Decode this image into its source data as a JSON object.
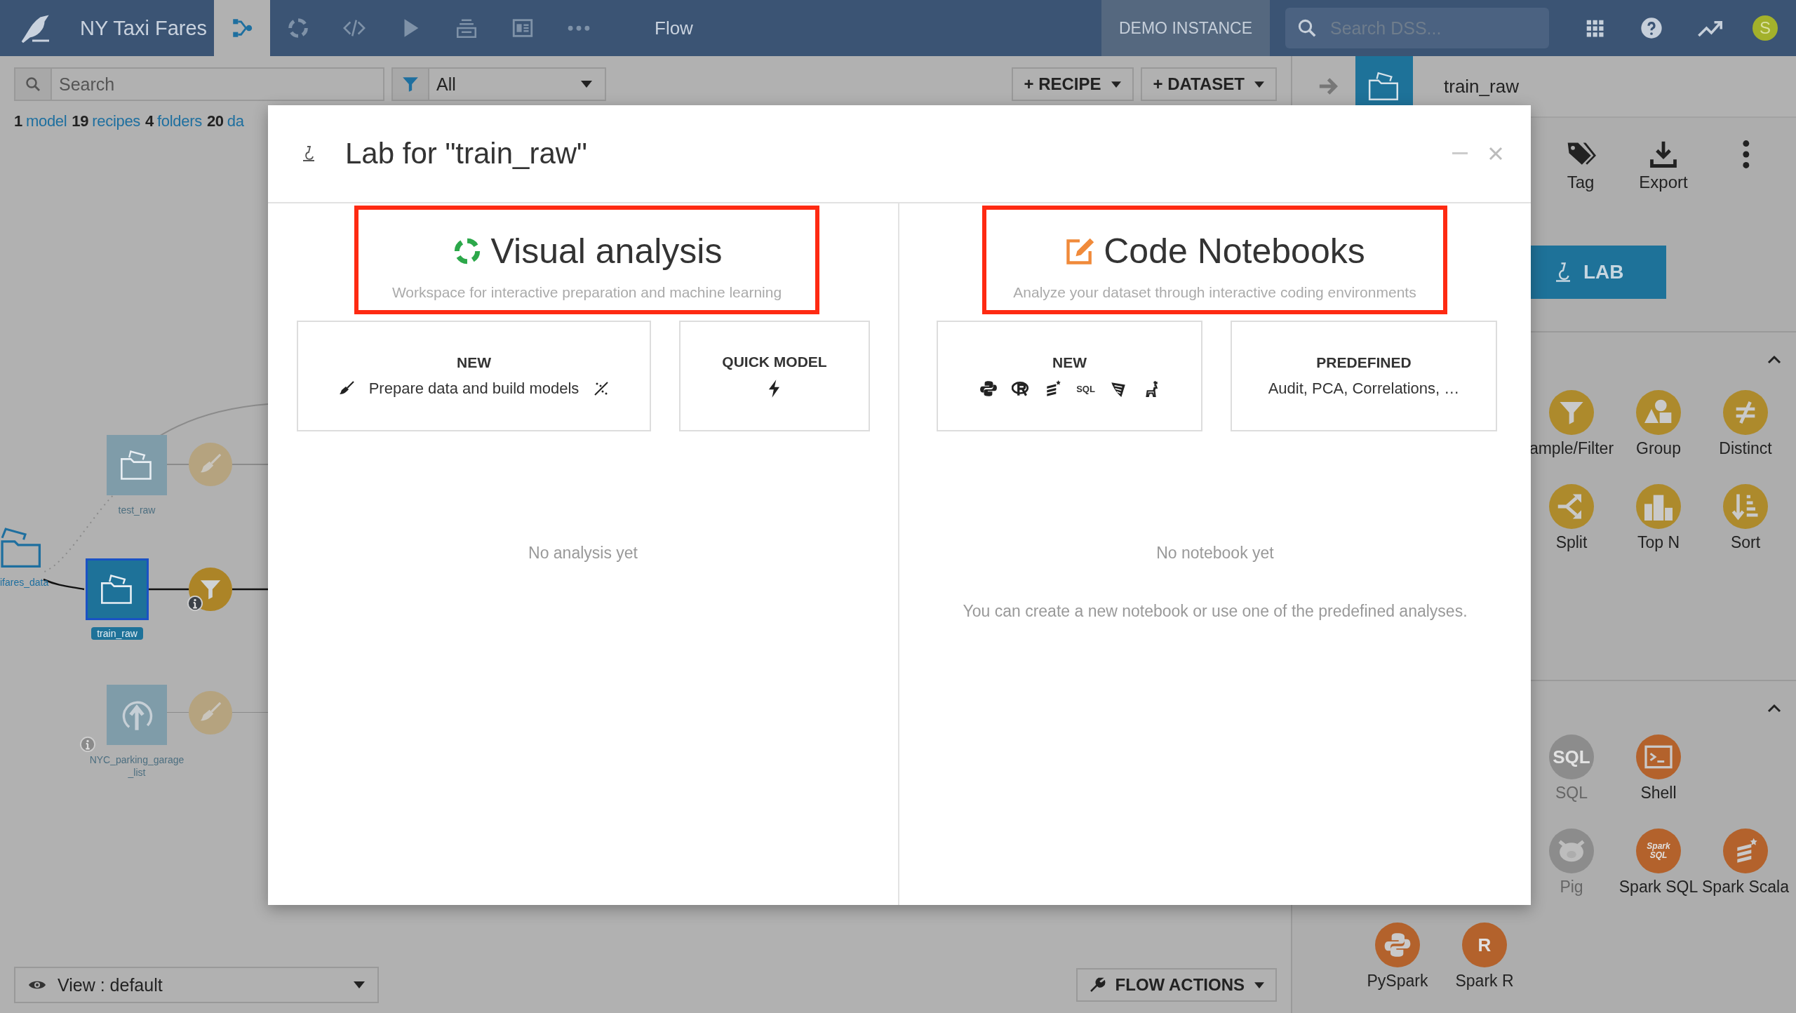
{
  "topbar": {
    "project": "NY Taxi Fares",
    "nav": [
      {
        "kind": "flow",
        "selected": true
      },
      {
        "kind": "analysis",
        "selected": false
      },
      {
        "kind": "code",
        "selected": false
      },
      {
        "kind": "run",
        "selected": false
      },
      {
        "kind": "stack",
        "selected": false
      },
      {
        "kind": "dashboard",
        "selected": false
      },
      {
        "kind": "more",
        "selected": false
      }
    ],
    "section": "Flow",
    "instance": "DEMO INSTANCE",
    "search": {
      "placeholder": "Search DSS..."
    },
    "avatar": "S"
  },
  "toolbar": {
    "search": {
      "placeholder": "Search"
    },
    "filter": "All",
    "buttons": [
      "+ RECIPE",
      "+ DATASET"
    ]
  },
  "stats": [
    {
      "count": "1",
      "label": "model"
    },
    {
      "count": "19",
      "label": "recipes"
    },
    {
      "count": "4",
      "label": "folders"
    },
    {
      "count": "20",
      "label": "da"
    }
  ],
  "flow": {
    "nodes": [
      {
        "kind": "dataset",
        "label": "test_raw",
        "faded": true,
        "selected": false,
        "info": false
      },
      {
        "kind": "folder",
        "label": "ifares_data",
        "faded": false,
        "selected": false,
        "info": false
      },
      {
        "kind": "dataset",
        "label": "train_raw",
        "faded": false,
        "selected": true,
        "info": false
      },
      {
        "kind": "upload",
        "label": "NYC_parking_garage_list",
        "faded": true,
        "selected": false,
        "info": true
      },
      {
        "kind": "prepare",
        "faded": true,
        "selected": false,
        "info": false
      },
      {
        "kind": "filter",
        "faded": false,
        "selected": false,
        "info": true
      },
      {
        "kind": "prepare",
        "faded": true,
        "selected": false,
        "info": false
      }
    ]
  },
  "view": "View : default",
  "flow_actions": "FLOW ACTIONS",
  "right_panel": {
    "item": "train_raw",
    "actions": [
      {
        "kind": "tag",
        "label": "Tag"
      },
      {
        "kind": "export",
        "label": "Export"
      },
      {
        "kind": "more"
      }
    ],
    "lab": "LAB",
    "sections": [
      {
        "expanded": true,
        "items": [
          {
            "kind": "filter",
            "label": "ample/Filter",
            "disabled": false
          },
          {
            "kind": "group",
            "label": "Group",
            "disabled": false
          },
          {
            "kind": "distinct",
            "label": "Distinct",
            "disabled": false
          },
          {
            "kind": "split",
            "label": "Split",
            "disabled": false
          },
          {
            "kind": "topn",
            "label": "Top N",
            "disabled": false
          },
          {
            "kind": "sort",
            "label": "Sort",
            "disabled": false
          }
        ]
      },
      {
        "expanded": true,
        "items": [
          {
            "kind": "sql",
            "label": "SQL",
            "glyph": "SQL",
            "disabled": true
          },
          {
            "kind": "shell",
            "label": "Shell",
            "disabled": false
          },
          {
            "kind": "pig",
            "label": "Pig",
            "disabled": true
          },
          {
            "kind": "sparksql",
            "label": "Spark SQL",
            "glyph": "Spark SQL",
            "disabled": false
          },
          {
            "kind": "sparkscala",
            "label": "Spark Scala",
            "disabled": false
          },
          {
            "kind": "pyspark",
            "label": "PySpark",
            "disabled": false
          },
          {
            "kind": "sparkr",
            "label": "Spark R",
            "glyph": "R",
            "disabled": false
          }
        ]
      }
    ]
  },
  "modal": {
    "title": "Lab for \"train_raw\"",
    "sections": [
      {
        "kind": "visual",
        "title": "Visual analysis",
        "subtitle": "Workspace for interactive preparation and machine learning",
        "highlighted": true,
        "cards": [
          {
            "kind": "new",
            "heading": "NEW",
            "text": "Prepare data and build models"
          },
          {
            "kind": "quick",
            "heading": "QUICK MODEL"
          }
        ],
        "empty": "No analysis yet"
      },
      {
        "kind": "code",
        "title": "Code Notebooks",
        "subtitle": "Analyze your dataset through interactive coding environments",
        "highlighted": true,
        "cards": [
          {
            "kind": "languages",
            "heading": "NEW",
            "icons": [
              {
                "kind": "python"
              },
              {
                "kind": "r"
              },
              {
                "kind": "scala"
              },
              {
                "kind": "sql",
                "label": "SQL"
              },
              {
                "kind": "spark"
              },
              {
                "kind": "deer"
              }
            ]
          },
          {
            "kind": "predefined",
            "heading": "PREDEFINED",
            "text": "Audit, PCA, Correlations, …"
          }
        ],
        "empty": "No notebook yet",
        "hint": "You can create a new notebook or use one of the predefined analyses."
      }
    ]
  }
}
